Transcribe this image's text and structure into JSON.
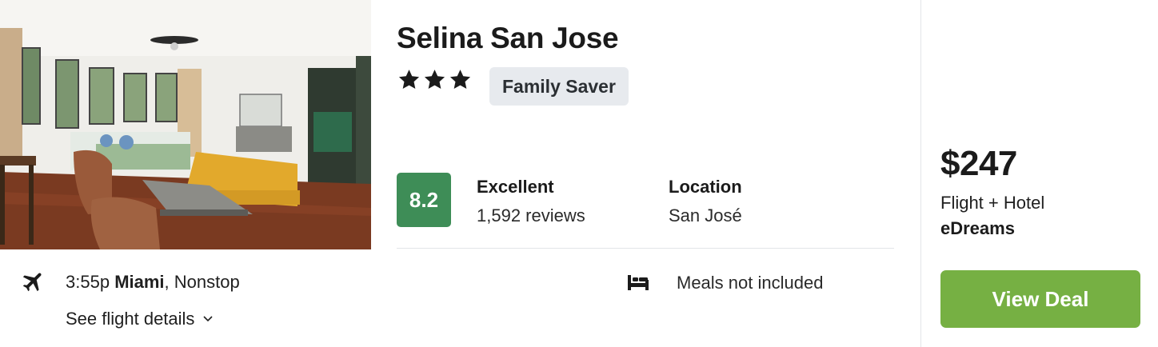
{
  "hotel": {
    "name": "Selina San Jose",
    "star_rating": 3,
    "badge": "Family Saver"
  },
  "rating": {
    "score": "8.2",
    "label": "Excellent",
    "reviews": "1,592 reviews",
    "score_color": "#3e8d57"
  },
  "location": {
    "label": "Location",
    "value": "San José"
  },
  "flight": {
    "time": "3:55p",
    "city": "Miami",
    "stops": ", Nonstop",
    "details_link": "See flight details"
  },
  "meals": {
    "text": "Meals not included"
  },
  "deal": {
    "price": "$247",
    "package": "Flight + Hotel",
    "provider": "eDreams",
    "button_label": "View Deal",
    "button_color": "#76b043"
  },
  "icons": {
    "flight": "airplane-icon",
    "meals": "bed-icon",
    "details": "chevron-down-icon",
    "star": "star-icon"
  }
}
